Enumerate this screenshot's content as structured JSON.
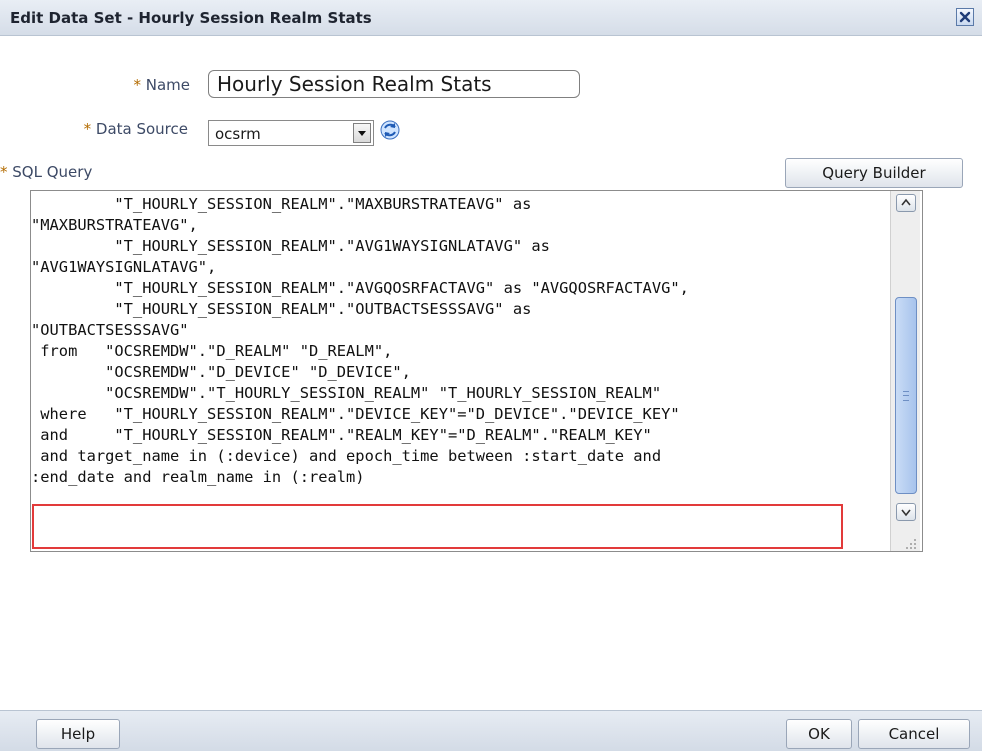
{
  "dialog": {
    "title": "Edit Data Set - Hourly Session Realm Stats"
  },
  "form": {
    "required_marker": "*",
    "name_label": "Name",
    "name_value": "Hourly Session Realm Stats",
    "data_source_label": "Data Source",
    "data_source_value": "ocsrm",
    "sql_label": "SQL Query",
    "query_builder_label": "Query Builder"
  },
  "sql": {
    "main_text": "         \"T_HOURLY_SESSION_REALM\".\"MAXBURSTRATEAVG\" as\n\"MAXBURSTRATEAVG\",\n         \"T_HOURLY_SESSION_REALM\".\"AVG1WAYSIGNLATAVG\" as\n\"AVG1WAYSIGNLATAVG\",\n         \"T_HOURLY_SESSION_REALM\".\"AVGQOSRFACTAVG\" as \"AVGQOSRFACTAVG\",\n         \"T_HOURLY_SESSION_REALM\".\"OUTBACTSESSSAVG\" as\n\"OUTBACTSESSSAVG\"\n from   \"OCSREMDW\".\"D_REALM\" \"D_REALM\",\n        \"OCSREMDW\".\"D_DEVICE\" \"D_DEVICE\",\n        \"OCSREMDW\".\"T_HOURLY_SESSION_REALM\" \"T_HOURLY_SESSION_REALM\"\n where   \"T_HOURLY_SESSION_REALM\".\"DEVICE_KEY\"=\"D_DEVICE\".\"DEVICE_KEY\"\n and     \"T_HOURLY_SESSION_REALM\".\"REALM_KEY\"=\"D_REALM\".\"REALM_KEY\"",
    "highlighted_text": " and target_name in (:device) and epoch_time between :start_date and\n:end_date and realm_name in (:realm)"
  },
  "footer": {
    "help_label": "Help",
    "ok_label": "OK",
    "cancel_label": "Cancel"
  },
  "icons": {
    "close": "close-icon",
    "refresh": "refresh-icon",
    "dropdown": "chevron-down-icon",
    "scroll_up": "chevron-up-icon",
    "scroll_down": "chevron-down-icon",
    "resize": "resize-grip-icon"
  },
  "colors": {
    "required_marker": "#b36b00",
    "label_text": "#3d4a66",
    "highlight_border": "#e23a3a",
    "scroll_thumb": "#a7c3ec"
  }
}
